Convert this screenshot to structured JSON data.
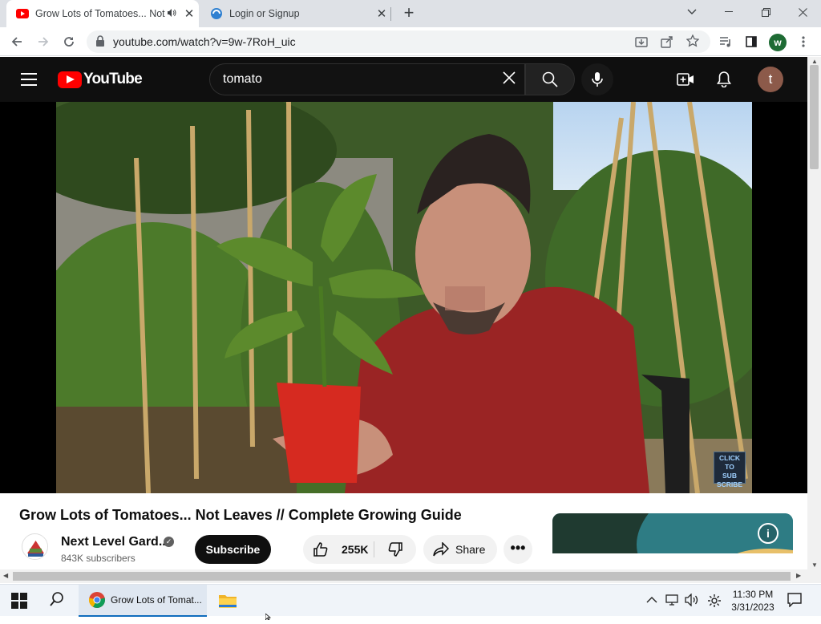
{
  "browser": {
    "tabs": [
      {
        "title": "Grow Lots of Tomatoes... Not Leaves // Complete Growing Guide",
        "close": "✕",
        "audio": true
      },
      {
        "title": "Login or Signup",
        "close": "✕"
      }
    ],
    "new_tab": "+",
    "url": "youtube.com/watch?v=9w-7RoH_uic",
    "profile_initial": "w"
  },
  "youtube": {
    "logo_text": "YouTube",
    "search_query": "tomato",
    "avatar_initial": "t",
    "video_overlay": {
      "line1": "CLICK TO",
      "line2": "SUB",
      "line3": "SCRIBE"
    },
    "video_title": "Grow Lots of Tomatoes... Not Leaves // Complete Growing Guide",
    "channel_name": "Next Level Gard...",
    "subscribers": "843K subscribers",
    "subscribe_label": "Subscribe",
    "like_count": "255K",
    "share_label": "Share",
    "more_label": "•••",
    "info_label": "i"
  },
  "taskbar": {
    "chrome_item": "Grow Lots of Tomat...",
    "time": "11:30 PM",
    "date": "3/31/2023"
  },
  "colors": {
    "yt_red": "#ff0000",
    "yt_dark": "#0f0f0f",
    "tab_strip": "#dee1e6",
    "chrome_blue": "#0f6cbd"
  }
}
